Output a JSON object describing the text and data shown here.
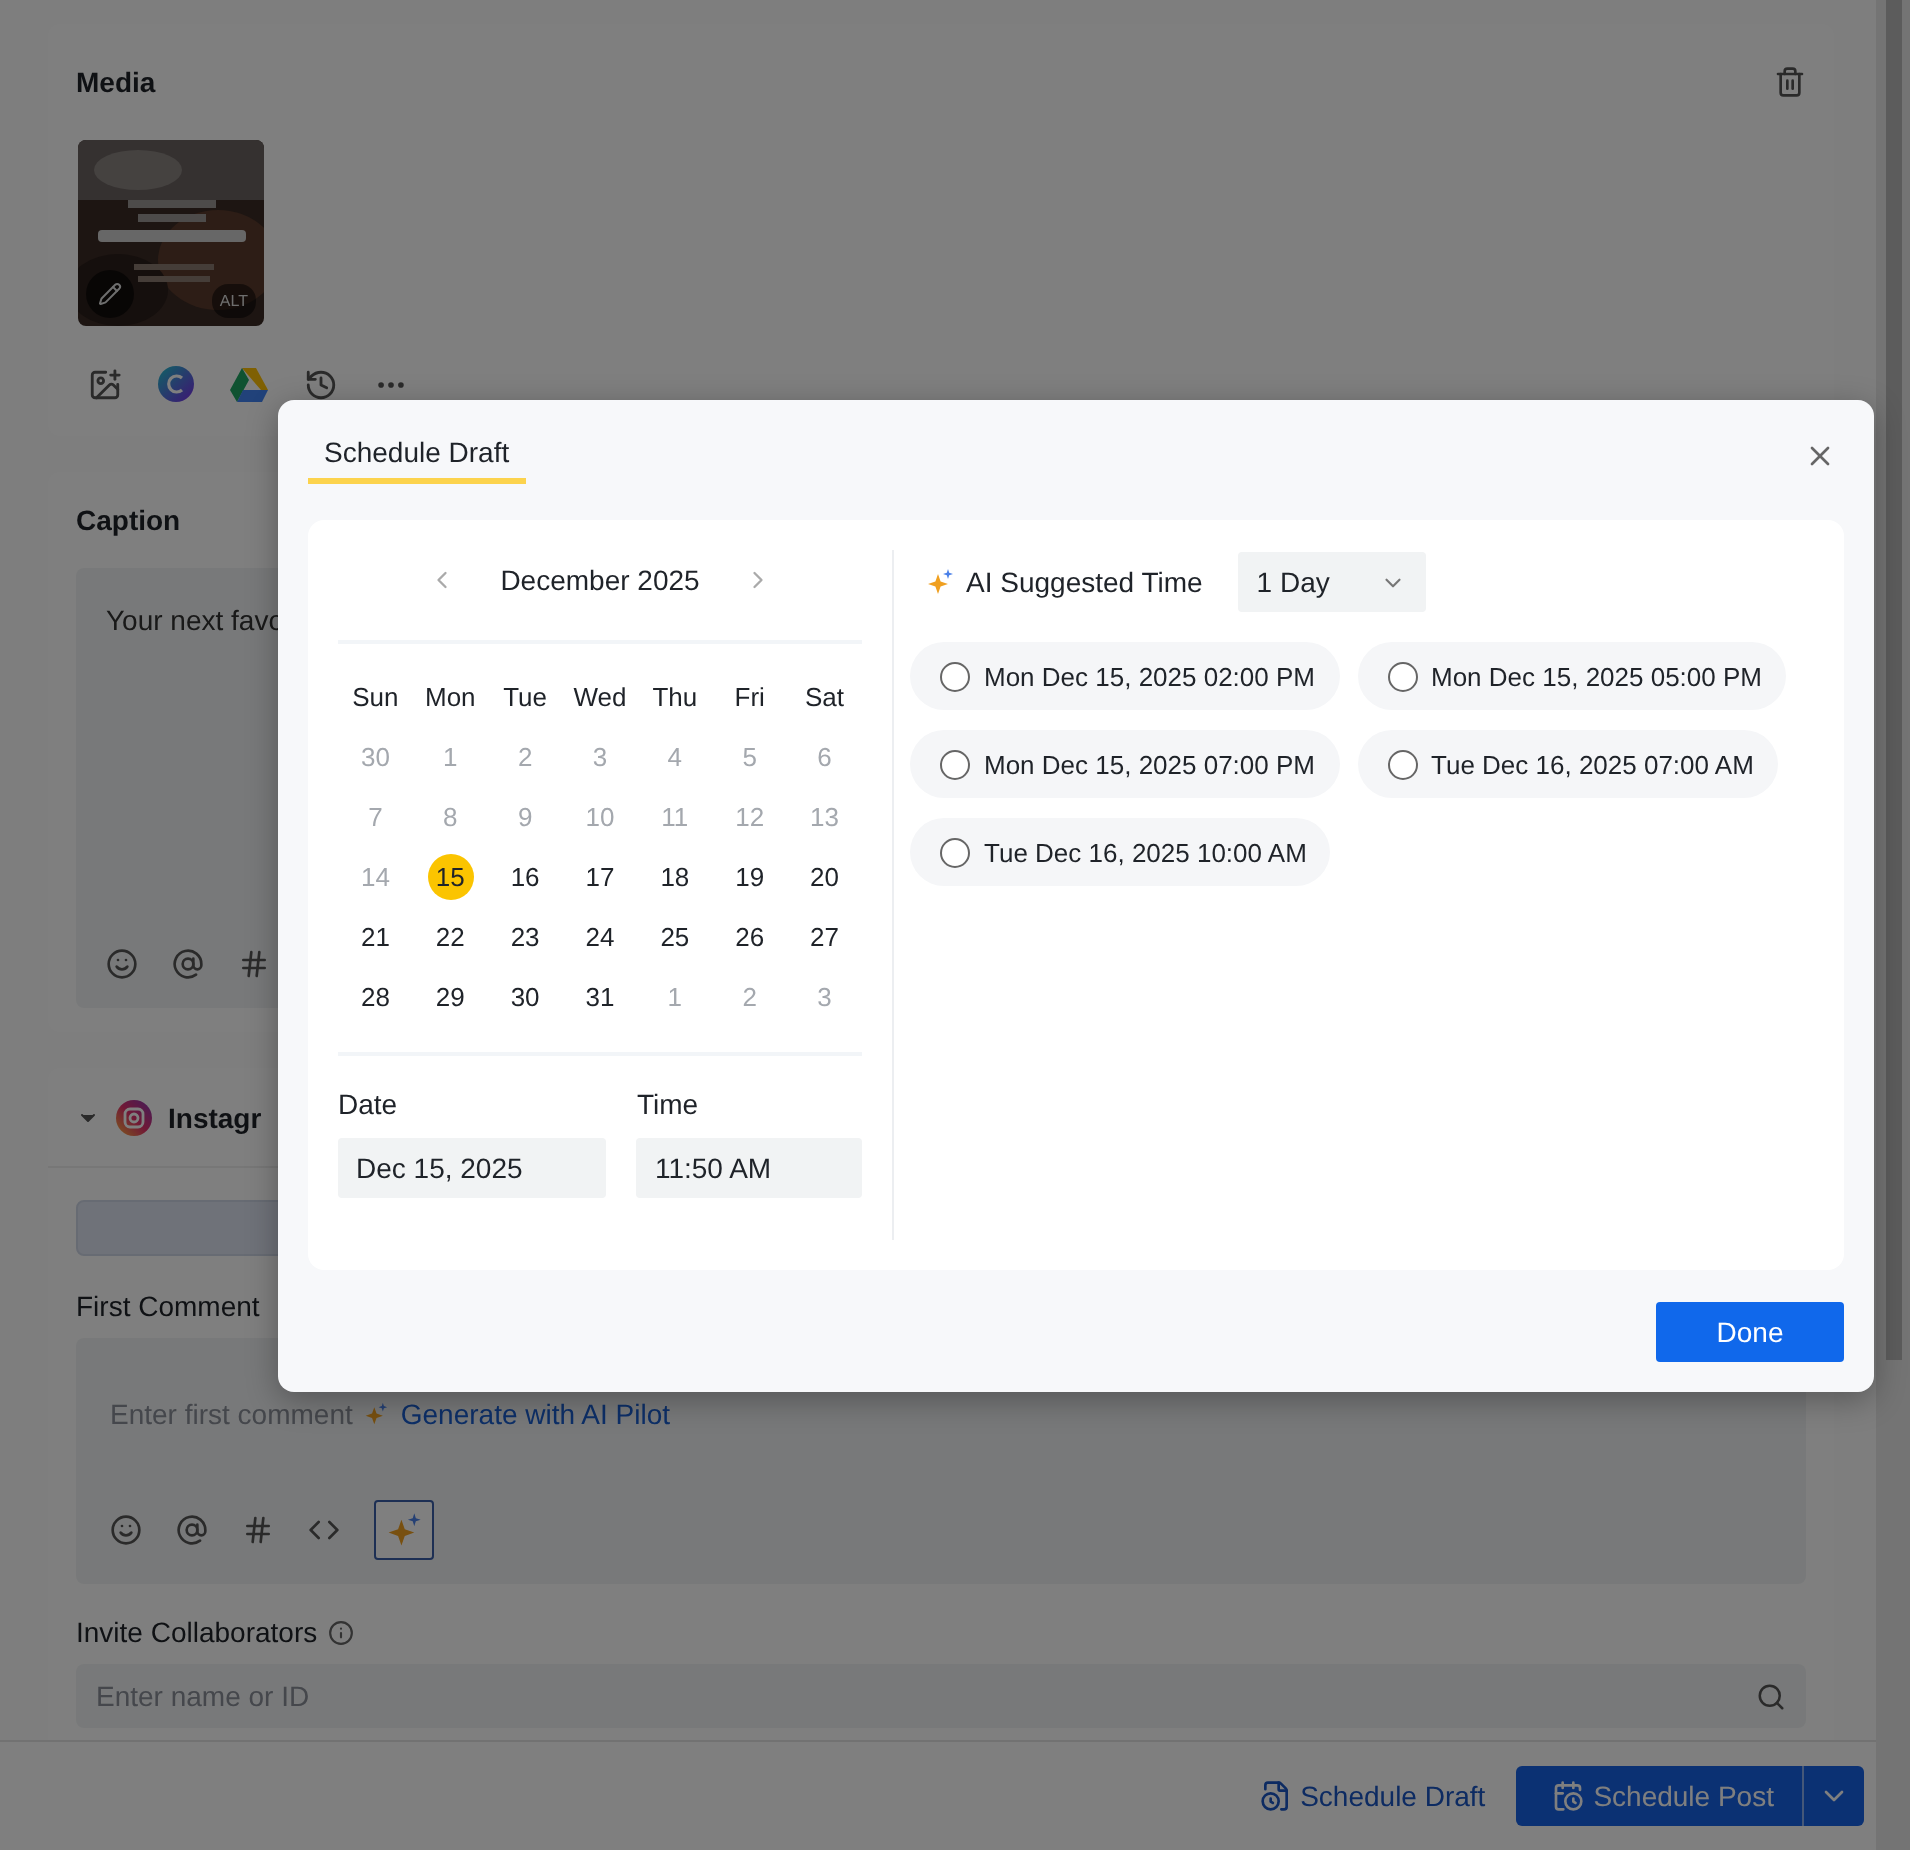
{
  "media": {
    "title": "Media",
    "alt_badge": "ALT"
  },
  "caption": {
    "title": "Caption",
    "value": "Your next favo"
  },
  "instagram": {
    "title": "Instagr"
  },
  "first_comment": {
    "label": "First Comment",
    "placeholder": "Enter first comment",
    "ai_link": "Generate with AI Pilot"
  },
  "collaborators": {
    "label": "Invite Collaborators",
    "placeholder": "Enter name or ID"
  },
  "footer": {
    "draft_button": "Schedule Draft",
    "post_button": "Schedule Post"
  },
  "dialog": {
    "tabs": [
      {
        "label": "Schedule Draft",
        "selected": true
      }
    ],
    "month": "December 2025",
    "weekdays": [
      "Sun",
      "Mon",
      "Tue",
      "Wed",
      "Thu",
      "Fri",
      "Sat"
    ],
    "days": [
      {
        "label": "30",
        "muted": true,
        "selected": false
      },
      {
        "label": "1",
        "muted": true,
        "selected": false
      },
      {
        "label": "2",
        "muted": true,
        "selected": false
      },
      {
        "label": "3",
        "muted": true,
        "selected": false
      },
      {
        "label": "4",
        "muted": true,
        "selected": false
      },
      {
        "label": "5",
        "muted": true,
        "selected": false
      },
      {
        "label": "6",
        "muted": true,
        "selected": false
      },
      {
        "label": "7",
        "muted": true,
        "selected": false
      },
      {
        "label": "8",
        "muted": true,
        "selected": false
      },
      {
        "label": "9",
        "muted": true,
        "selected": false
      },
      {
        "label": "10",
        "muted": true,
        "selected": false
      },
      {
        "label": "11",
        "muted": true,
        "selected": false
      },
      {
        "label": "12",
        "muted": true,
        "selected": false
      },
      {
        "label": "13",
        "muted": true,
        "selected": false
      },
      {
        "label": "14",
        "muted": true,
        "selected": false
      },
      {
        "label": "15",
        "muted": false,
        "selected": true
      },
      {
        "label": "16",
        "muted": false,
        "selected": false
      },
      {
        "label": "17",
        "muted": false,
        "selected": false
      },
      {
        "label": "18",
        "muted": false,
        "selected": false
      },
      {
        "label": "19",
        "muted": false,
        "selected": false
      },
      {
        "label": "20",
        "muted": false,
        "selected": false
      },
      {
        "label": "21",
        "muted": false,
        "selected": false
      },
      {
        "label": "22",
        "muted": false,
        "selected": false
      },
      {
        "label": "23",
        "muted": false,
        "selected": false
      },
      {
        "label": "24",
        "muted": false,
        "selected": false
      },
      {
        "label": "25",
        "muted": false,
        "selected": false
      },
      {
        "label": "26",
        "muted": false,
        "selected": false
      },
      {
        "label": "27",
        "muted": false,
        "selected": false
      },
      {
        "label": "28",
        "muted": false,
        "selected": false
      },
      {
        "label": "29",
        "muted": false,
        "selected": false
      },
      {
        "label": "30",
        "muted": false,
        "selected": false
      },
      {
        "label": "31",
        "muted": false,
        "selected": false
      },
      {
        "label": "1",
        "muted": true,
        "selected": false
      },
      {
        "label": "2",
        "muted": true,
        "selected": false
      },
      {
        "label": "3",
        "muted": true,
        "selected": false
      }
    ],
    "date": {
      "label": "Date",
      "value": "Dec 15, 2025"
    },
    "time": {
      "label": "Time",
      "value": "11:50 AM"
    },
    "ai": {
      "label": "AI Suggested Time",
      "period": "1 Day"
    },
    "suggestions": [
      {
        "label": "Mon Dec 15, 2025 02:00 PM",
        "selected": false
      },
      {
        "label": "Mon Dec 15, 2025 05:00 PM",
        "selected": false
      },
      {
        "label": "Mon Dec 15, 2025 07:00 PM",
        "selected": false
      },
      {
        "label": "Tue Dec 16, 2025 07:00 AM",
        "selected": false
      },
      {
        "label": "Tue Dec 16, 2025 10:00 AM",
        "selected": false
      }
    ],
    "done": "Done"
  }
}
